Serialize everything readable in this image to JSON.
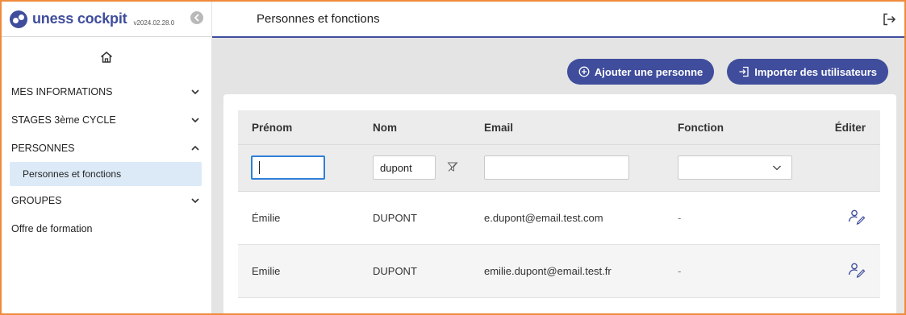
{
  "app": {
    "name": "uness cockpit",
    "version": "v2024.02.28.0",
    "accent_color": "#3f4d9c"
  },
  "sidebar": {
    "home_icon": "home-icon",
    "items": [
      {
        "label": "MES INFORMATIONS",
        "expanded": false
      },
      {
        "label": "STAGES 3ème CYCLE",
        "expanded": false
      },
      {
        "label": "PERSONNES",
        "expanded": true
      },
      {
        "label": "GROUPES",
        "expanded": false
      },
      {
        "label": "Offre de formation"
      }
    ],
    "sub_item": {
      "label": "Personnes et fonctions",
      "selected": true
    }
  },
  "header": {
    "title": "Personnes et fonctions"
  },
  "actions": {
    "add_person": "Ajouter une personne",
    "import_users": "Importer des utilisateurs"
  },
  "table": {
    "columns": [
      "Prénom",
      "Nom",
      "Email",
      "Fonction",
      "Éditer"
    ],
    "filters": {
      "prenom": "",
      "nom": "dupont",
      "email": "",
      "fonction": ""
    },
    "rows": [
      {
        "prenom": "Émilie",
        "nom": "DUPONT",
        "email": "e.dupont@email.test.com",
        "fonction": "-"
      },
      {
        "prenom": "Emilie",
        "nom": "DUPONT",
        "email": "emilie.dupont@email.test.fr",
        "fonction": "-"
      }
    ]
  }
}
